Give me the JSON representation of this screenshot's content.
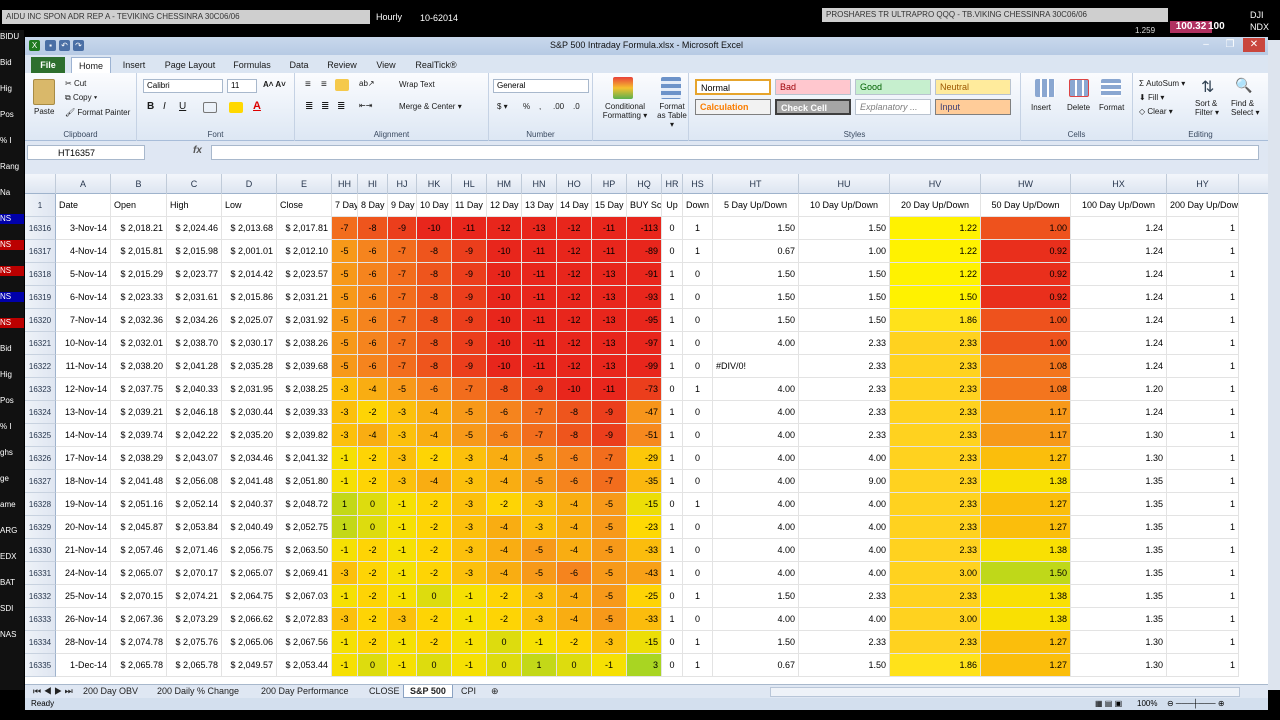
{
  "background": {
    "top_title_left": "AIDU INC SPON ADR REP A - TEVIKING CHESSINRA 30C06/06",
    "hourly": "Hourly",
    "date": "10-62014",
    "top_title_right": "PROSHARES TR ULTRAPRO QQQ - TB.VIKING CHESSINRA 30C06/06",
    "quote_price": "100.32",
    "quote_value": "100",
    "ticker1": "DJI",
    "ticker2": "NDX",
    "code": "1.259",
    "left_labels": [
      "BIDU",
      "Bid",
      "Hig",
      "Pos",
      "% I",
      "Rang",
      "Na",
      "NS",
      "NS",
      "NS",
      "NS",
      "NS",
      "Bid",
      "Hig",
      "Pos",
      "% I",
      "ghs",
      "ge",
      "ame",
      "ARG",
      "EDX",
      "BAT",
      "SDI",
      "NAS"
    ]
  },
  "window": {
    "title": "S&P 500 Intraday Formula.xlsx - Microsoft Excel",
    "min": "–",
    "max": "❐",
    "close": "✕"
  },
  "tabs": [
    "File",
    "Home",
    "Insert",
    "Page Layout",
    "Formulas",
    "Data",
    "Review",
    "View",
    "RealTick®"
  ],
  "ribbon": {
    "clipboard": {
      "paste": "Paste",
      "cut": "Cut",
      "copy": "Copy ▾",
      "format_painter": "Format Painter",
      "label": "Clipboard"
    },
    "font": {
      "name": "Calibri",
      "size": "11",
      "bold": "B",
      "italic": "I",
      "underline": "U",
      "label": "Font"
    },
    "alignment": {
      "wrap": "Wrap Text",
      "merge": "Merge & Center ▾",
      "label": "Alignment"
    },
    "number": {
      "format": "General",
      "currency": "$ ▾",
      "percent": "%",
      "comma": ",",
      "dec_inc": ".00",
      "dec_dec": ".0",
      "label": "Number"
    },
    "conditional": "Conditional Formatting ▾",
    "format_table": "Format as Table ▾",
    "styles": {
      "normal": "Normal",
      "bad": "Bad",
      "good": "Good",
      "neutral": "Neutral",
      "calculation": "Calculation",
      "check_cell": "Check Cell",
      "explanatory": "Explanatory ...",
      "input": "Input",
      "label": "Styles"
    },
    "cells": {
      "insert": "Insert",
      "delete": "Delete",
      "format": "Format",
      "label": "Cells"
    },
    "editing": {
      "autosum": "AutoSum ▾",
      "fill": "Fill ▾",
      "clear": "Clear ▾",
      "sort": "Sort & Filter ▾",
      "find": "Find & Select ▾",
      "label": "Editing"
    }
  },
  "formula_bar": {
    "name_box": "HT16357",
    "fx": "fx",
    "formula": ""
  },
  "columns": [
    "A",
    "B",
    "C",
    "D",
    "E",
    "HH",
    "HI",
    "HJ",
    "HK",
    "HL",
    "HM",
    "HN",
    "HO",
    "HP",
    "HQ",
    "HR",
    "HS",
    "HT",
    "HU",
    "HV",
    "HW",
    "HX",
    "HY"
  ],
  "header_row": {
    "row_num": "1",
    "cells": [
      "Date",
      "Open",
      "High",
      "Low",
      "Close",
      "7 Day",
      "8 Day",
      "9 Day",
      "10 Day",
      "11 Day",
      "12 Day",
      "13 Day",
      "14 Day",
      "15 Day",
      "BUY Score",
      "Up",
      "Down",
      "5 Day Up/Down",
      "10 Day Up/Down",
      "20 Day Up/Down",
      "50 Day Up/Down",
      "100 Day Up/Down",
      "200 Day Up/Down"
    ]
  },
  "rows": [
    {
      "n": "16316",
      "d": "3-Nov-14",
      "o": "$ 2,018.21",
      "h": "$ 2,024.46",
      "lo": "$ 2,013.68",
      "c": "$ 2,017.81",
      "days": [
        "-7",
        "-8",
        "-9",
        "-10",
        "-11",
        "-12",
        "-13",
        "-12",
        "-11"
      ],
      "buy": "-113",
      "up": "0",
      "down": "1",
      "ud5": "1.50",
      "ud10": "1.50",
      "ud20": "1.22",
      "ud50": "1.00",
      "ud100": "1.24",
      "ud200": "1"
    },
    {
      "n": "16317",
      "d": "4-Nov-14",
      "o": "$ 2,015.81",
      "h": "$ 2,015.98",
      "lo": "$ 2,001.01",
      "c": "$ 2,012.10",
      "days": [
        "-5",
        "-6",
        "-7",
        "-8",
        "-9",
        "-10",
        "-11",
        "-12",
        "-11"
      ],
      "buy": "-89",
      "up": "0",
      "down": "1",
      "ud5": "0.67",
      "ud10": "1.00",
      "ud20": "1.22",
      "ud50": "0.92",
      "ud100": "1.24",
      "ud200": "1"
    },
    {
      "n": "16318",
      "d": "5-Nov-14",
      "o": "$ 2,015.29",
      "h": "$ 2,023.77",
      "lo": "$ 2,014.42",
      "c": "$ 2,023.57",
      "days": [
        "-5",
        "-6",
        "-7",
        "-8",
        "-9",
        "-10",
        "-11",
        "-12",
        "-13"
      ],
      "buy": "-91",
      "up": "1",
      "down": "0",
      "ud5": "1.50",
      "ud10": "1.50",
      "ud20": "1.22",
      "ud50": "0.92",
      "ud100": "1.24",
      "ud200": "1"
    },
    {
      "n": "16319",
      "d": "6-Nov-14",
      "o": "$ 2,023.33",
      "h": "$ 2,031.61",
      "lo": "$ 2,015.86",
      "c": "$ 2,031.21",
      "days": [
        "-5",
        "-6",
        "-7",
        "-8",
        "-9",
        "-10",
        "-11",
        "-12",
        "-13"
      ],
      "buy": "-93",
      "up": "1",
      "down": "0",
      "ud5": "1.50",
      "ud10": "1.50",
      "ud20": "1.50",
      "ud50": "0.92",
      "ud100": "1.24",
      "ud200": "1"
    },
    {
      "n": "16320",
      "d": "7-Nov-14",
      "o": "$ 2,032.36",
      "h": "$ 2,034.26",
      "lo": "$ 2,025.07",
      "c": "$ 2,031.92",
      "days": [
        "-5",
        "-6",
        "-7",
        "-8",
        "-9",
        "-10",
        "-11",
        "-12",
        "-13"
      ],
      "buy": "-95",
      "up": "1",
      "down": "0",
      "ud5": "1.50",
      "ud10": "1.50",
      "ud20": "1.86",
      "ud50": "1.00",
      "ud100": "1.24",
      "ud200": "1"
    },
    {
      "n": "16321",
      "d": "10-Nov-14",
      "o": "$ 2,032.01",
      "h": "$ 2,038.70",
      "lo": "$ 2,030.17",
      "c": "$ 2,038.26",
      "days": [
        "-5",
        "-6",
        "-7",
        "-8",
        "-9",
        "-10",
        "-11",
        "-12",
        "-13"
      ],
      "buy": "-97",
      "up": "1",
      "down": "0",
      "ud5": "4.00",
      "ud10": "2.33",
      "ud20": "2.33",
      "ud50": "1.00",
      "ud100": "1.24",
      "ud200": "1"
    },
    {
      "n": "16322",
      "d": "11-Nov-14",
      "o": "$ 2,038.20",
      "h": "$ 2,041.28",
      "lo": "$ 2,035.28",
      "c": "$ 2,039.68",
      "days": [
        "-5",
        "-6",
        "-7",
        "-8",
        "-9",
        "-10",
        "-11",
        "-12",
        "-13"
      ],
      "buy": "-99",
      "up": "1",
      "down": "0",
      "ud5": "#DIV/0!",
      "ud10": "2.33",
      "ud20": "2.33",
      "ud50": "1.08",
      "ud100": "1.24",
      "ud200": "1"
    },
    {
      "n": "16323",
      "d": "12-Nov-14",
      "o": "$ 2,037.75",
      "h": "$ 2,040.33",
      "lo": "$ 2,031.95",
      "c": "$ 2,038.25",
      "days": [
        "-3",
        "-4",
        "-5",
        "-6",
        "-7",
        "-8",
        "-9",
        "-10",
        "-11"
      ],
      "buy": "-73",
      "up": "0",
      "down": "1",
      "ud5": "4.00",
      "ud10": "2.33",
      "ud20": "2.33",
      "ud50": "1.08",
      "ud100": "1.20",
      "ud200": "1"
    },
    {
      "n": "16324",
      "d": "13-Nov-14",
      "o": "$ 2,039.21",
      "h": "$ 2,046.18",
      "lo": "$ 2,030.44",
      "c": "$ 2,039.33",
      "days": [
        "-3",
        "-2",
        "-3",
        "-4",
        "-5",
        "-6",
        "-7",
        "-8",
        "-9"
      ],
      "buy": "-47",
      "up": "1",
      "down": "0",
      "ud5": "4.00",
      "ud10": "2.33",
      "ud20": "2.33",
      "ud50": "1.17",
      "ud100": "1.24",
      "ud200": "1"
    },
    {
      "n": "16325",
      "d": "14-Nov-14",
      "o": "$ 2,039.74",
      "h": "$ 2,042.22",
      "lo": "$ 2,035.20",
      "c": "$ 2,039.82",
      "days": [
        "-3",
        "-4",
        "-3",
        "-4",
        "-5",
        "-6",
        "-7",
        "-8",
        "-9"
      ],
      "buy": "-51",
      "up": "1",
      "down": "0",
      "ud5": "4.00",
      "ud10": "2.33",
      "ud20": "2.33",
      "ud50": "1.17",
      "ud100": "1.30",
      "ud200": "1"
    },
    {
      "n": "16326",
      "d": "17-Nov-14",
      "o": "$ 2,038.29",
      "h": "$ 2,043.07",
      "lo": "$ 2,034.46",
      "c": "$ 2,041.32",
      "days": [
        "-1",
        "-2",
        "-3",
        "-2",
        "-3",
        "-4",
        "-5",
        "-6",
        "-7"
      ],
      "buy": "-29",
      "up": "1",
      "down": "0",
      "ud5": "4.00",
      "ud10": "4.00",
      "ud20": "2.33",
      "ud50": "1.27",
      "ud100": "1.30",
      "ud200": "1"
    },
    {
      "n": "16327",
      "d": "18-Nov-14",
      "o": "$ 2,041.48",
      "h": "$ 2,056.08",
      "lo": "$ 2,041.48",
      "c": "$ 2,051.80",
      "days": [
        "-1",
        "-2",
        "-3",
        "-4",
        "-3",
        "-4",
        "-5",
        "-6",
        "-7"
      ],
      "buy": "-35",
      "up": "1",
      "down": "0",
      "ud5": "4.00",
      "ud10": "9.00",
      "ud20": "2.33",
      "ud50": "1.38",
      "ud100": "1.35",
      "ud200": "1"
    },
    {
      "n": "16328",
      "d": "19-Nov-14",
      "o": "$ 2,051.16",
      "h": "$ 2,052.14",
      "lo": "$ 2,040.37",
      "c": "$ 2,048.72",
      "days": [
        "1",
        "0",
        "-1",
        "-2",
        "-3",
        "-2",
        "-3",
        "-4",
        "-5"
      ],
      "buy": "-15",
      "up": "0",
      "down": "1",
      "ud5": "4.00",
      "ud10": "4.00",
      "ud20": "2.33",
      "ud50": "1.27",
      "ud100": "1.35",
      "ud200": "1"
    },
    {
      "n": "16329",
      "d": "20-Nov-14",
      "o": "$ 2,045.87",
      "h": "$ 2,053.84",
      "lo": "$ 2,040.49",
      "c": "$ 2,052.75",
      "days": [
        "1",
        "0",
        "-1",
        "-2",
        "-3",
        "-4",
        "-3",
        "-4",
        "-5"
      ],
      "buy": "-23",
      "up": "1",
      "down": "0",
      "ud5": "4.00",
      "ud10": "4.00",
      "ud20": "2.33",
      "ud50": "1.27",
      "ud100": "1.35",
      "ud200": "1"
    },
    {
      "n": "16330",
      "d": "21-Nov-14",
      "o": "$ 2,057.46",
      "h": "$ 2,071.46",
      "lo": "$ 2,056.75",
      "c": "$ 2,063.50",
      "days": [
        "-1",
        "-2",
        "-1",
        "-2",
        "-3",
        "-4",
        "-5",
        "-4",
        "-5"
      ],
      "buy": "-33",
      "up": "1",
      "down": "0",
      "ud5": "4.00",
      "ud10": "4.00",
      "ud20": "2.33",
      "ud50": "1.38",
      "ud100": "1.35",
      "ud200": "1"
    },
    {
      "n": "16331",
      "d": "24-Nov-14",
      "o": "$ 2,065.07",
      "h": "$ 2,070.17",
      "lo": "$ 2,065.07",
      "c": "$ 2,069.41",
      "days": [
        "-3",
        "-2",
        "-1",
        "-2",
        "-3",
        "-4",
        "-5",
        "-6",
        "-5"
      ],
      "buy": "-43",
      "up": "1",
      "down": "0",
      "ud5": "4.00",
      "ud10": "4.00",
      "ud20": "3.00",
      "ud50": "1.50",
      "ud100": "1.35",
      "ud200": "1"
    },
    {
      "n": "16332",
      "d": "25-Nov-14",
      "o": "$ 2,070.15",
      "h": "$ 2,074.21",
      "lo": "$ 2,064.75",
      "c": "$ 2,067.03",
      "days": [
        "-1",
        "-2",
        "-1",
        "0",
        "-1",
        "-2",
        "-3",
        "-4",
        "-5"
      ],
      "buy": "-25",
      "up": "0",
      "down": "1",
      "ud5": "1.50",
      "ud10": "2.33",
      "ud20": "2.33",
      "ud50": "1.38",
      "ud100": "1.35",
      "ud200": "1"
    },
    {
      "n": "16333",
      "d": "26-Nov-14",
      "o": "$ 2,067.36",
      "h": "$ 2,073.29",
      "lo": "$ 2,066.62",
      "c": "$ 2,072.83",
      "days": [
        "-3",
        "-2",
        "-3",
        "-2",
        "-1",
        "-2",
        "-3",
        "-4",
        "-5"
      ],
      "buy": "-33",
      "up": "1",
      "down": "0",
      "ud5": "4.00",
      "ud10": "4.00",
      "ud20": "3.00",
      "ud50": "1.38",
      "ud100": "1.35",
      "ud200": "1"
    },
    {
      "n": "16334",
      "d": "28-Nov-14",
      "o": "$ 2,074.78",
      "h": "$ 2,075.76",
      "lo": "$ 2,065.06",
      "c": "$ 2,067.56",
      "days": [
        "-1",
        "-2",
        "-1",
        "-2",
        "-1",
        "0",
        "-1",
        "-2",
        "-3"
      ],
      "buy": "-15",
      "up": "0",
      "down": "1",
      "ud5": "1.50",
      "ud10": "2.33",
      "ud20": "2.33",
      "ud50": "1.27",
      "ud100": "1.30",
      "ud200": "1"
    },
    {
      "n": "16335",
      "d": "1-Dec-14",
      "o": "$ 2,065.78",
      "h": "$ 2,065.78",
      "lo": "$ 2,049.57",
      "c": "$ 2,053.44",
      "days": [
        "-1",
        "0",
        "-1",
        "0",
        "-1",
        "0",
        "1",
        "0",
        "-1"
      ],
      "buy": "3",
      "up": "0",
      "down": "1",
      "ud5": "0.67",
      "ud10": "1.50",
      "ud20": "1.86",
      "ud50": "1.27",
      "ud100": "1.30",
      "ud200": "1"
    }
  ],
  "sheet_tabs": [
    "200 Day OBV",
    "200 Daily % Change",
    "200 Day Performance",
    "CLOSE",
    "S&P 500",
    "CPI"
  ],
  "status": {
    "ready": "Ready",
    "zoom": "100%"
  },
  "colors": {
    "accent": "#2e6f2e",
    "red": "#e8261c",
    "yellow": "#ffef00",
    "green": "#8fd12c"
  }
}
